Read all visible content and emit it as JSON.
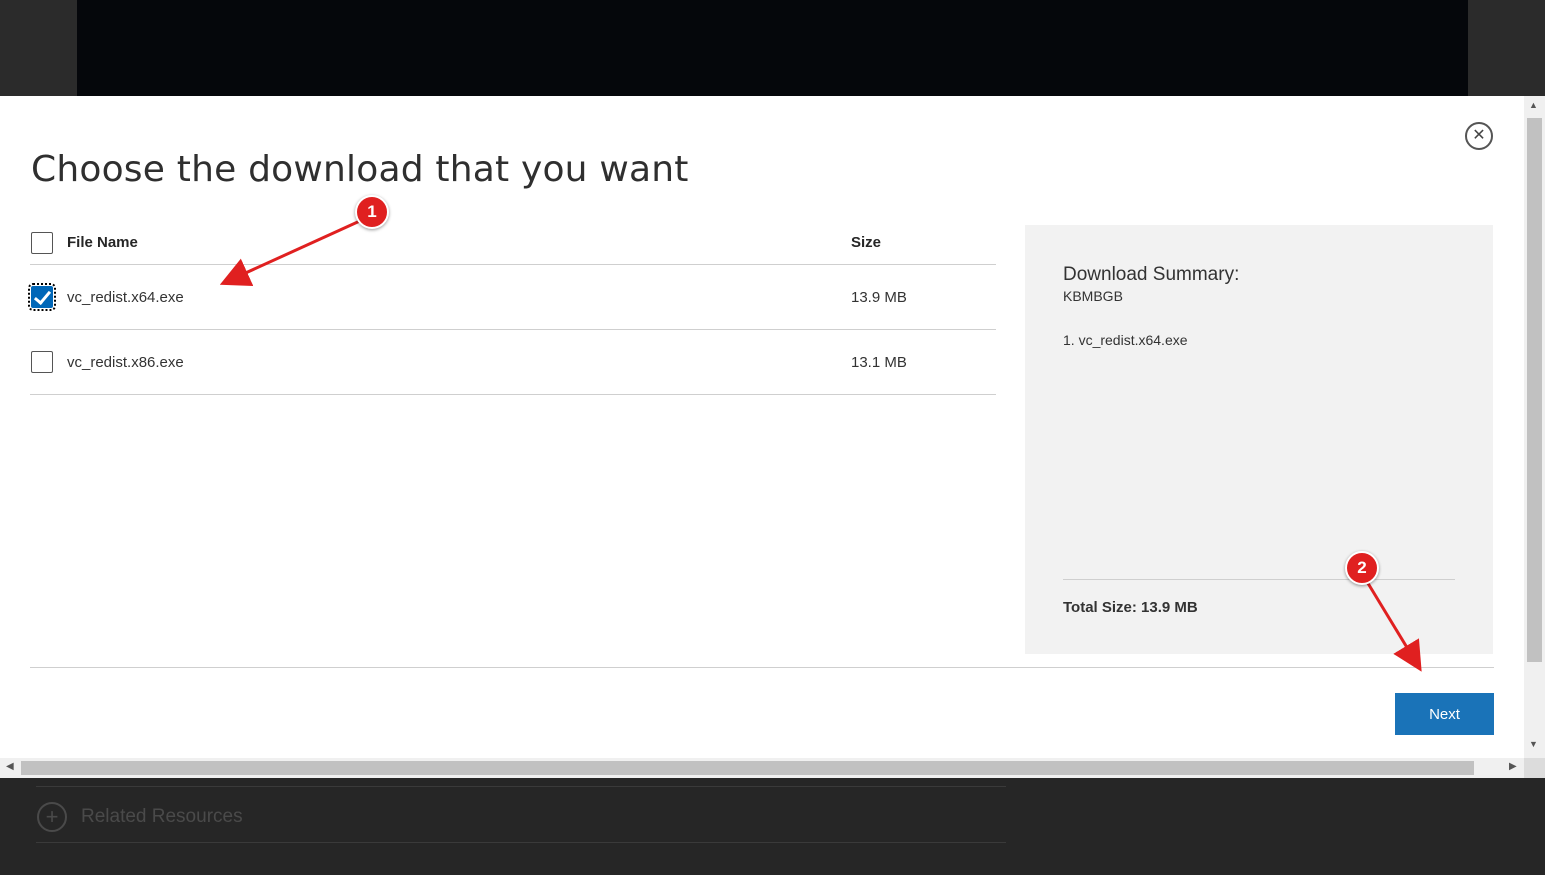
{
  "dialog": {
    "title": "Choose the download that you want",
    "close_label": "⊗"
  },
  "table": {
    "header": {
      "name": "File Name",
      "size": "Size",
      "checked": false
    },
    "rows": [
      {
        "name": "vc_redist.x64.exe",
        "size": "13.9 MB",
        "checked": true
      },
      {
        "name": "vc_redist.x86.exe",
        "size": "13.1 MB",
        "checked": false
      }
    ]
  },
  "summary": {
    "title": "Download Summary:",
    "subtitle": "KBMBGB",
    "items": [
      "1.  vc_redist.x64.exe"
    ],
    "total": "Total Size: 13.9 MB"
  },
  "actions": {
    "next_label": "Next"
  },
  "footer": {
    "related_label": "Related Resources",
    "icon": "plus-circle-icon"
  },
  "annotations": {
    "badge1": "1",
    "badge2": "2",
    "color": "#e02020"
  },
  "colors": {
    "accent": "#1a73b8",
    "checkbox": "#0067b8",
    "summary_bg": "#f2f2f2"
  }
}
